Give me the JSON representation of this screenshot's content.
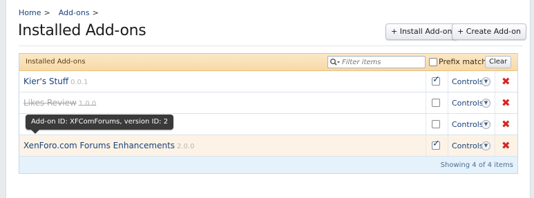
{
  "breadcrumb": {
    "home": "Home",
    "addons": "Add-ons",
    "sep": ">"
  },
  "page": {
    "title": "Installed Add-ons"
  },
  "actions": {
    "install": "+ Install Add-on",
    "create": "+ Create Add-on"
  },
  "list": {
    "header_title": "Installed Add-ons",
    "filter_placeholder": "Filter items",
    "prefix_label": "Prefix match",
    "clear_label": "Clear",
    "controls_label": "Controls",
    "rows": [
      {
        "name": "Kier's Stuff",
        "version": "0.0.1",
        "enabled": true,
        "highlighted": false
      },
      {
        "name": "Likes Review",
        "version": "1.0.0",
        "enabled": false,
        "highlighted": false
      },
      {
        "name": "",
        "version": "",
        "enabled": false,
        "highlighted": false
      },
      {
        "name": "XenForo.com Forums Enhancements",
        "version": "2.0.0",
        "enabled": true,
        "highlighted": true
      }
    ],
    "footer": "Showing 4 of 4 items"
  },
  "tooltip": "Add-on ID: XFComForums, version ID: 2",
  "colors": {
    "link": "#19417a",
    "header_bg": "#f7d9a6",
    "delete": "#d82626",
    "footer_bg": "#e5f1fb"
  }
}
